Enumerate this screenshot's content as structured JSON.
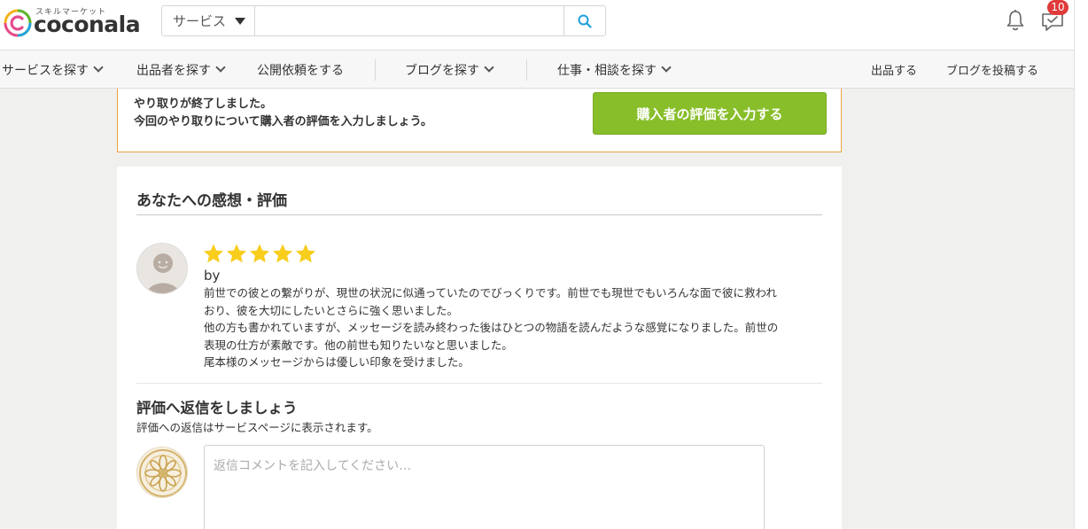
{
  "header": {
    "logo_small": "スキルマーケット",
    "logo_text": "coconala",
    "search_category": "サービス",
    "search_placeholder": "",
    "notification_count": "10"
  },
  "nav": {
    "items": [
      {
        "label": "サービスを探す"
      },
      {
        "label": "出品者を探す"
      },
      {
        "label": "公開依頼をする"
      },
      {
        "label": "ブログを探す"
      },
      {
        "label": "仕事・相談を探す"
      },
      {
        "label": "出品する"
      },
      {
        "label": "ブログを投稿する"
      }
    ]
  },
  "notice": {
    "line1": "やり取りが終了しました。",
    "line2": "今回のやり取りについて購入者の評価を入力しましょう。",
    "button": "購入者の評価を入力する"
  },
  "review_section": {
    "title": "あなたへの感想・評価",
    "rating": 5,
    "by": "by",
    "lines": [
      "前世での彼との繋がりが、現世の状況に似通っていたのでびっくりです。前世でも現世でもいろんな面で彼に救われ",
      "おり、彼を大切にしたいとさらに強く思いました。",
      "他の方も書かれていますが、メッセージを読み終わった後はひとつの物語を読んだような感覚になりました。前世の",
      "表現の仕方が素敵です。他の前世も知りたいなと思いました。",
      "尾本様のメッセージからは優しい印象を受けました。"
    ]
  },
  "reply_section": {
    "title": "評価へ返信をしましょう",
    "subtitle": "評価への返信はサービスページに表示されます。",
    "placeholder": "返信コメントを記入してください…"
  },
  "colors": {
    "accent_green": "#88be2a",
    "notice_border": "#e8a33c",
    "star": "#f8cd1c",
    "badge": "#e03a3a"
  }
}
